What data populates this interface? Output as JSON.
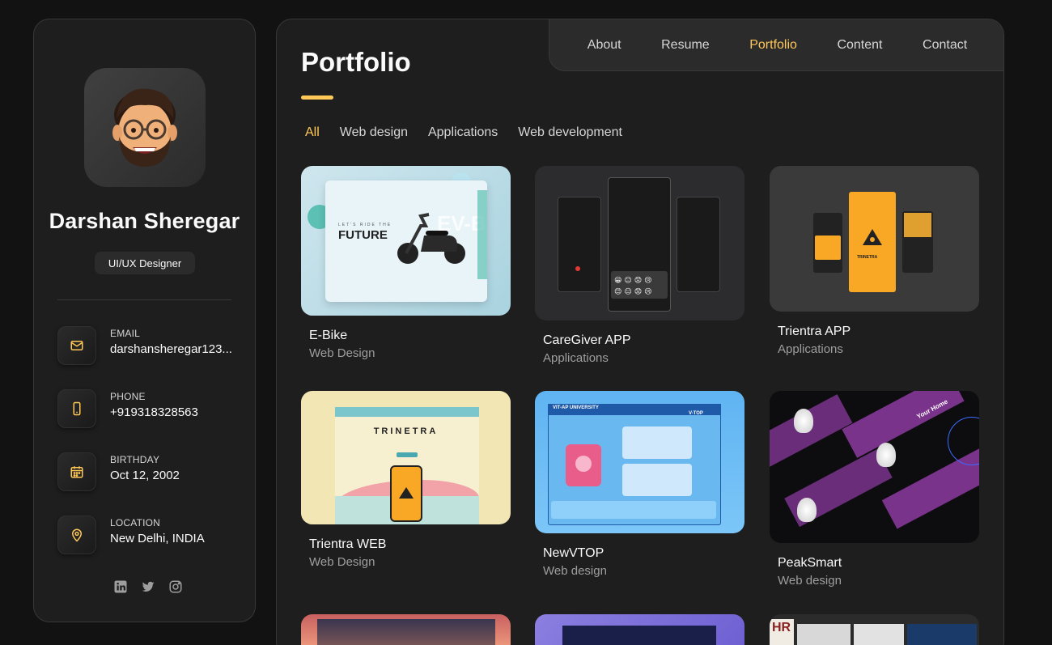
{
  "profile": {
    "name": "Darshan Sheregar",
    "role": "UI/UX Designer"
  },
  "contacts": [
    {
      "label": "EMAIL",
      "value": "darshansheregar123...",
      "icon": "mail-icon"
    },
    {
      "label": "PHONE",
      "value": "+919318328563",
      "icon": "phone-icon"
    },
    {
      "label": "BIRTHDAY",
      "value": "Oct 12, 2002",
      "icon": "calendar-icon"
    },
    {
      "label": "LOCATION",
      "value": "New Delhi, INDIA",
      "icon": "location-icon"
    }
  ],
  "socials": [
    "linkedin-icon",
    "twitter-icon",
    "instagram-icon"
  ],
  "nav": {
    "items": [
      "About",
      "Resume",
      "Portfolio",
      "Content",
      "Contact"
    ],
    "active": "Portfolio"
  },
  "page": {
    "title": "Portfolio"
  },
  "filters": {
    "items": [
      "All",
      "Web design",
      "Applications",
      "Web development"
    ],
    "active": "All"
  },
  "projects": [
    {
      "title": "E-Bike",
      "category": "Web Design"
    },
    {
      "title": "CareGiver APP",
      "category": "Applications"
    },
    {
      "title": "Trientra APP",
      "category": "Applications"
    },
    {
      "title": "Trientra WEB",
      "category": "Web Design"
    },
    {
      "title": "NewVTOP",
      "category": "Web design"
    },
    {
      "title": "PeakSmart",
      "category": "Web design"
    }
  ],
  "thumb_text": {
    "ebike_headline": "FUTURE",
    "ebike_tag": "LET'S RIDE THE",
    "ebike_big": "EV-B",
    "trinetra_logo": "TRINETRA",
    "vtop_header": "VIT-AP UNIVERSITY",
    "vtop_tag": "V-TOP",
    "peaksmart_tagline": "Your Home",
    "hr_logo": "HR"
  },
  "colors": {
    "accent": "#ffc857",
    "background": "#121212",
    "panel": "#1e1e1f"
  }
}
